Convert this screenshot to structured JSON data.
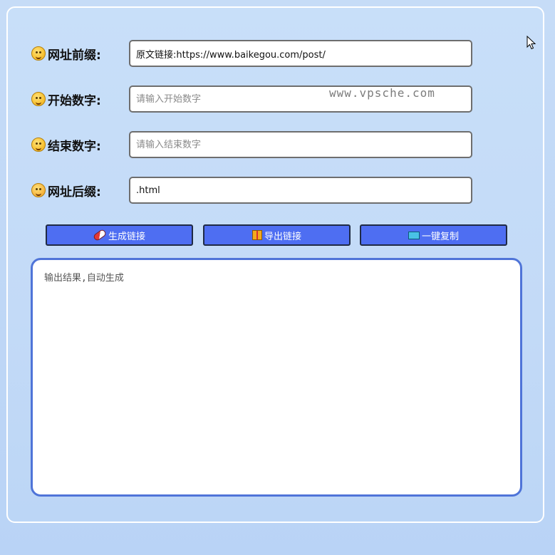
{
  "form": {
    "prefix": {
      "label": "网址前缀:",
      "emoji": "grinning-face-icon",
      "value": "原文链接:https://www.baikegou.com/post/",
      "placeholder": ""
    },
    "start": {
      "label": "开始数字:",
      "emoji": "tongue-face-icon",
      "value": "",
      "placeholder": "请输入开始数字"
    },
    "end": {
      "label": "结束数字:",
      "emoji": "savoring-face-icon",
      "value": "",
      "placeholder": "请输入结束数字"
    },
    "suffix": {
      "label": "网址后缀:",
      "emoji": "hearts-face-icon",
      "value": ".html",
      "placeholder": ""
    }
  },
  "watermark": "www.vpsche.com",
  "buttons": {
    "generate": {
      "label": "生成链接",
      "icon": "pill-icon"
    },
    "export": {
      "label": "导出链接",
      "icon": "gift-icon"
    },
    "copy": {
      "label": "一键复制",
      "icon": "ticket-icon"
    }
  },
  "output": {
    "placeholder": "输出结果,自动生成",
    "value": ""
  },
  "colors": {
    "button_bg": "#4e6ef2",
    "output_border": "#4f74d8",
    "background": "#c6dcf7"
  }
}
